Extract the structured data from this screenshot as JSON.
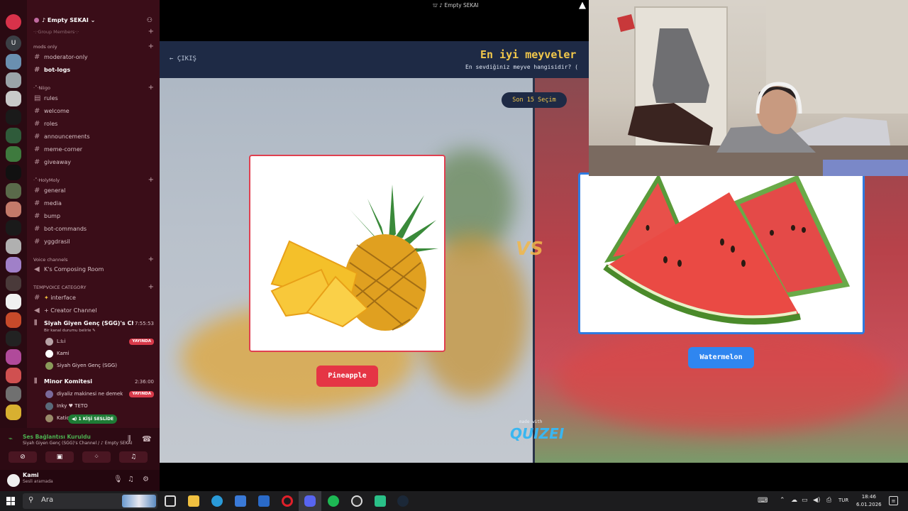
{
  "window": {
    "title": "♪ Empty SEKAI"
  },
  "sidebar": {
    "server_name": "♪ Empty SEKAI",
    "rail_letter": "U",
    "categories": [
      {
        "name": "mods only"
      },
      {
        "name": "·˚·Niigo"
      },
      {
        "name": "·˚·HolyMoly"
      },
      {
        "name": "Voice channels"
      },
      {
        "name": "TEMPVOICE CATEGORY"
      }
    ],
    "faded_top": "·:·Group Members·:·",
    "channels": {
      "moderator_only": "moderator-only",
      "bot_logs": "bot-logs",
      "rules": "rules",
      "welcome": "welcome",
      "roles": "roles",
      "announcements": "announcements",
      "meme_corner": "meme-corner",
      "giveaway": "giveaway",
      "general": "general",
      "media": "media",
      "bump": "bump",
      "bot_commands": "bot-commands",
      "yggdrasil": "yggdrasil",
      "composing_room": "K's Composing Room",
      "interface": "interface",
      "creator_channel": "Creator Channel"
    },
    "voice_channel_1": {
      "name": "Siyah Giyen Genç (SGG)'s Cha...",
      "status": "Bir kanal durumu belirle",
      "time": "7:55:53",
      "users": [
        {
          "name": "ᒪ:ᖶi",
          "badge": "YAYINDA"
        },
        {
          "name": "Kami"
        },
        {
          "name": "Siyah Giyen Genç (SGG)"
        }
      ]
    },
    "voice_channel_2": {
      "name": "Minor Komitesi",
      "time": "2:36:00",
      "users": [
        {
          "name": "diyaliz makinesi ne demek",
          "badge": "YAYINDA"
        },
        {
          "name": "Inky ♥ TETO"
        },
        {
          "name": "Katio"
        }
      ]
    },
    "popup": "1 KİŞİ SESLİDE",
    "voice_panel": {
      "status": "Ses Bağlantısı Kuruldu",
      "sub": "Siyah Giyen Genç (SGG)'s Channel / ♪ Empty SEKAI"
    },
    "user": {
      "name": "Kami",
      "status": "Sesli aramada"
    }
  },
  "quiz": {
    "exit_label": "ÇIKIŞ",
    "title": "En iyi meyveler",
    "subtitle": "En sevdiğiniz meyve hangisidir? (",
    "recent_pill": "Son 15 Seçim",
    "vs": "VS",
    "left": {
      "label": "Pineapple"
    },
    "right": {
      "label": "Watermelon"
    },
    "made_with": "made with",
    "brand": "QUIZEI"
  },
  "taskbar": {
    "search_placeholder": "Ara",
    "language": "TUR",
    "time": "18:46",
    "date": "6.01.2026"
  },
  "colors": {
    "sidebar_bg": "#3a0d18",
    "quiz_header_bg": "#1e2a45",
    "quiz_title": "#f2c84b",
    "left_accent": "#e53545",
    "right_accent": "#2f86f0",
    "live_badge": "#d83a4a"
  }
}
